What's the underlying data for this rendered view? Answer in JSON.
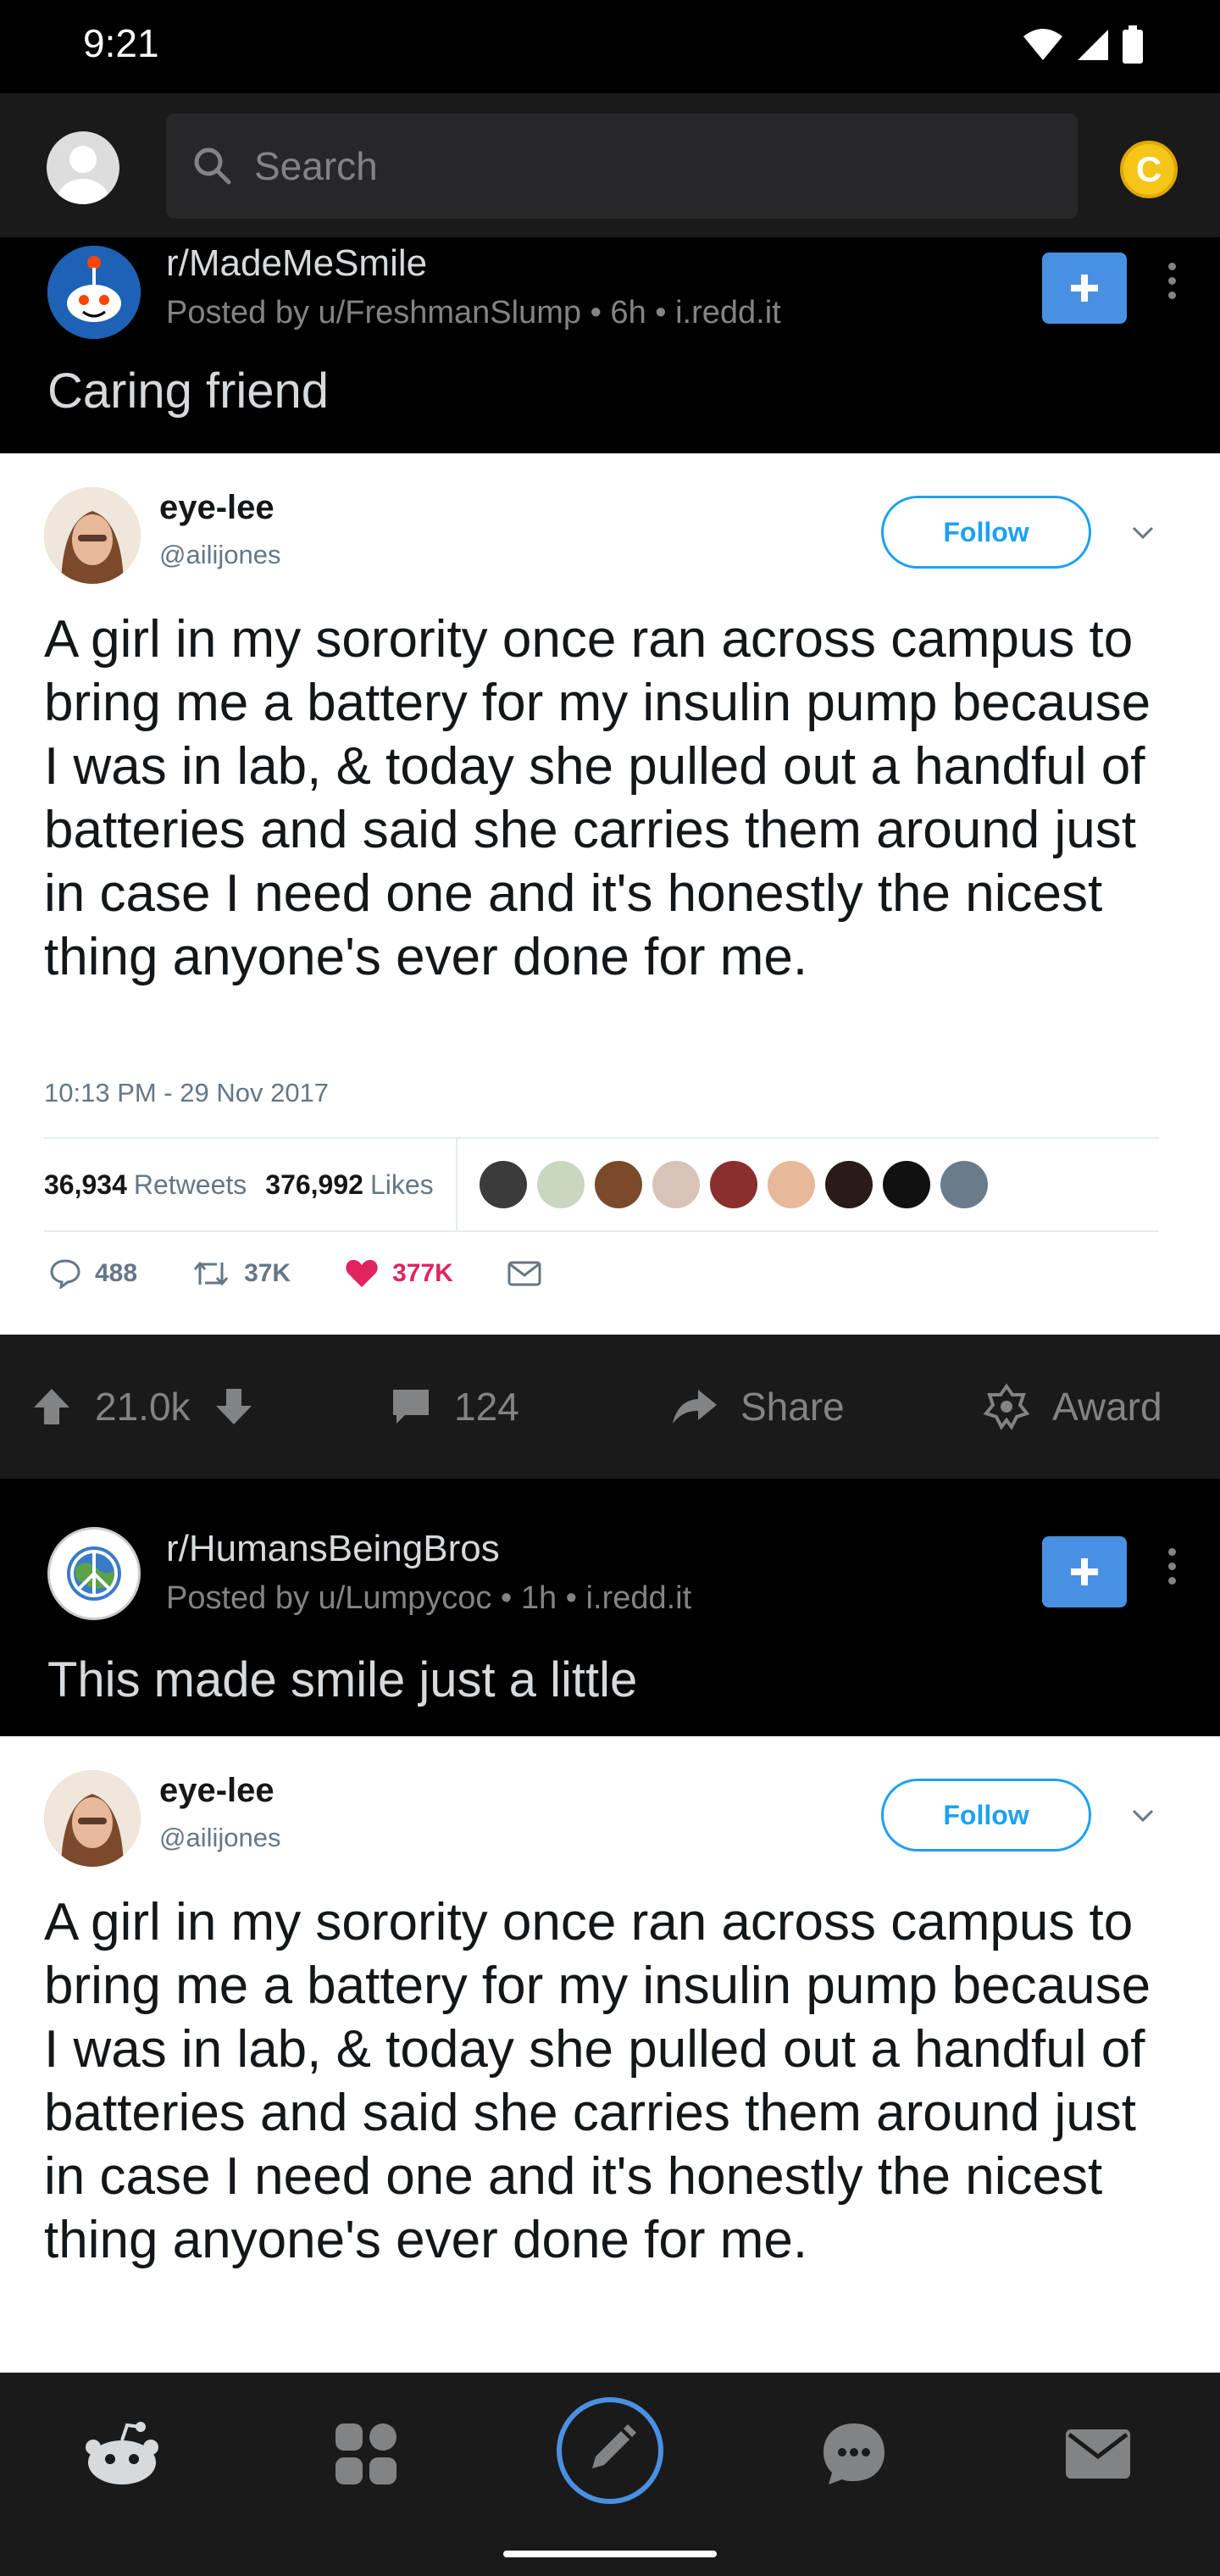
{
  "status_bar": {
    "time": "9:21"
  },
  "search": {
    "placeholder": "Search"
  },
  "coin": {
    "label": "C"
  },
  "posts": [
    {
      "subreddit": "r/MadeMeSmile",
      "meta": "Posted by u/FreshmanSlump • 6h • i.redd.it",
      "title": "Caring friend",
      "tweet": {
        "name": "eye-lee",
        "handle": "@ailijones",
        "follow_label": "Follow",
        "text": "A girl in my sorority once ran across campus to bring me a battery for my insulin pump because I was in lab, & today she pulled out a handful of batteries and said she carries them around just in case I need one and it's honestly the nicest thing anyone's ever done for me.",
        "date": "10:13 PM - 29 Nov 2017",
        "retweets_num": "36,934",
        "retweets_label": "Retweets",
        "likes_num": "376,992",
        "likes_label": "Likes",
        "replies": "488",
        "rt_short": "37K",
        "likes_short": "377K"
      },
      "votes": "21.0k",
      "comments": "124",
      "share_label": "Share",
      "award_label": "Award"
    },
    {
      "subreddit": "r/HumansBeingBros",
      "meta": "Posted by u/Lumpycoc • 1h • i.redd.it",
      "title": "This made smile just a little",
      "tweet": {
        "name": "eye-lee",
        "handle": "@ailijones",
        "follow_label": "Follow",
        "text": "A girl in my sorority once ran across campus to bring me a battery for my insulin pump because I was in lab, & today she pulled out a handful of batteries and said she carries them around just in case I need one and it's honestly the nicest thing anyone's ever done for me."
      }
    }
  ],
  "colors": {
    "accent": "#4a90e2",
    "twitter_blue": "#1da1f2",
    "like_red": "#e0245e",
    "coin": "#f5c518"
  }
}
